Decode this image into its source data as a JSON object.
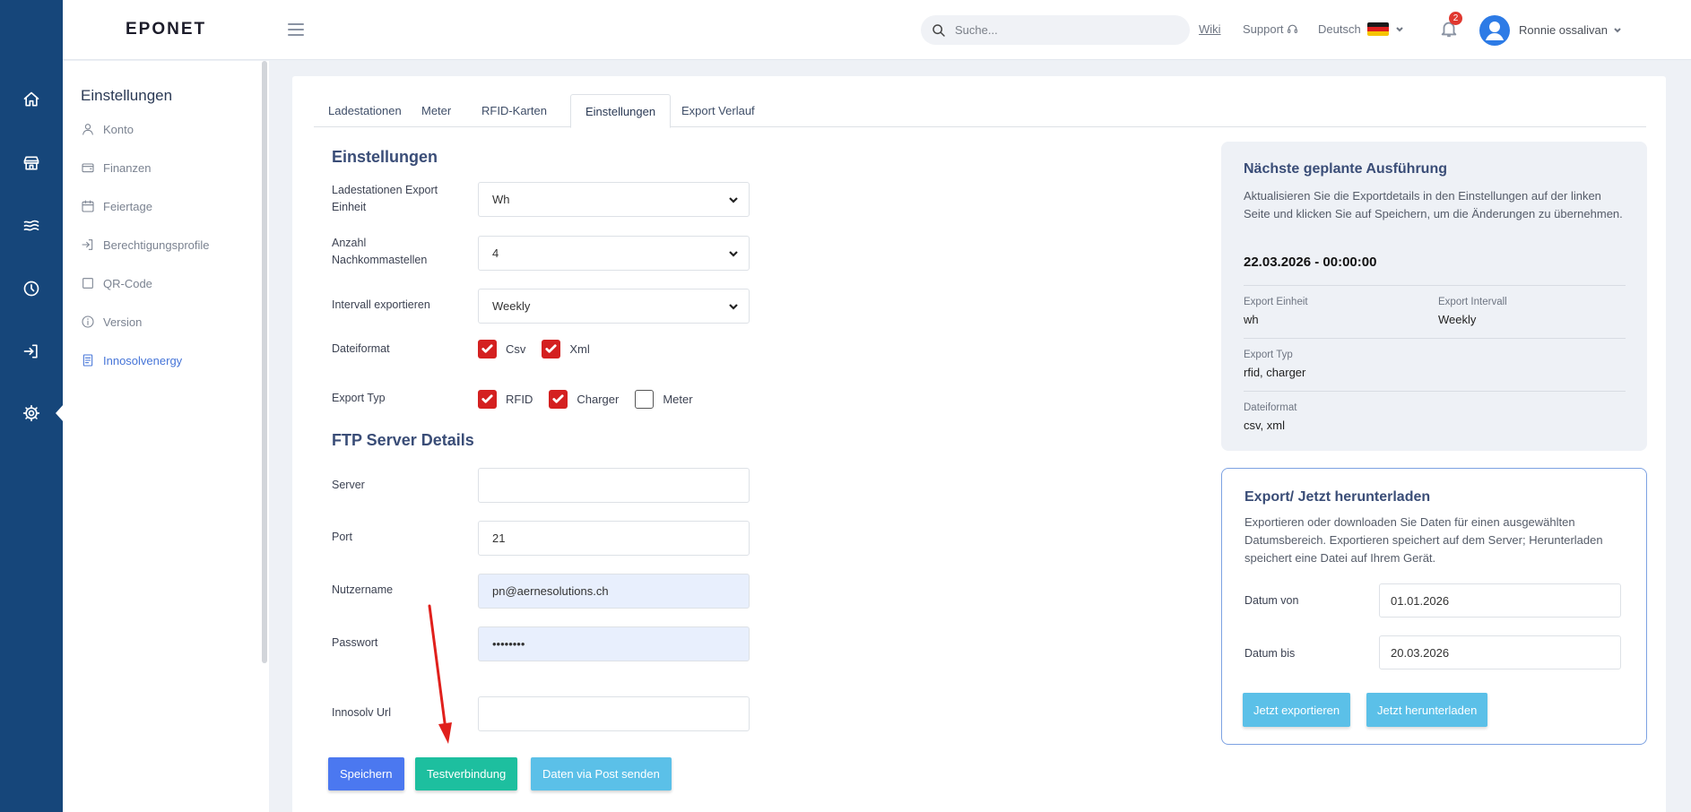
{
  "header": {
    "logo": "EPONET",
    "search_placeholder": "Suche...",
    "wiki": "Wiki",
    "support": "Support",
    "language": "Deutsch",
    "notification_count": "2",
    "username": "Ronnie ossalivan"
  },
  "sidebar": {
    "title": "Einstellungen",
    "items": [
      {
        "label": "Konto",
        "icon": "user-icon"
      },
      {
        "label": "Finanzen",
        "icon": "wallet-icon"
      },
      {
        "label": "Feiertage",
        "icon": "calendar-icon"
      },
      {
        "label": "Berechtigungsprofile",
        "icon": "login-icon"
      },
      {
        "label": "QR-Code",
        "icon": "square-icon"
      },
      {
        "label": "Version",
        "icon": "info-icon"
      },
      {
        "label": "Innosolvenergy",
        "icon": "document-icon",
        "active": true
      }
    ]
  },
  "tabs": [
    "Ladestationen",
    "Meter",
    "RFID-Karten",
    "Einstellungen",
    "Export Verlauf"
  ],
  "active_tab": "Einstellungen",
  "settings": {
    "title": "Einstellungen",
    "export_unit_label_1": "Ladestationen Export",
    "export_unit_label_2": "Einheit",
    "export_unit_value": "Wh",
    "decimals_label_1": "Anzahl",
    "decimals_label_2": "Nachkommastellen",
    "decimals_value": "4",
    "interval_label": "Intervall exportieren",
    "interval_value": "Weekly",
    "format_label": "Dateiformat",
    "format_csv": "Csv",
    "format_xml": "Xml",
    "type_label": "Export Typ",
    "type_rfid": "RFID",
    "type_charger": "Charger",
    "type_meter": "Meter"
  },
  "ftp": {
    "title": "FTP Server Details",
    "server_label": "Server",
    "server_value": "",
    "port_label": "Port",
    "port_value": "21",
    "user_label": "Nutzername",
    "user_value": "pn@aernesolutions.ch",
    "password_label": "Passwort",
    "password_value": "••••••••",
    "url_label": "Innosolv Url",
    "url_value": ""
  },
  "buttons": {
    "save": "Speichern",
    "test": "Testverbindung",
    "post": "Daten via Post senden"
  },
  "next_run": {
    "title": "Nächste geplante Ausführung",
    "desc": "Aktualisieren Sie die Exportdetails in den Einstellungen auf der linken Seite und klicken Sie auf Speichern, um die Änderungen zu übernehmen.",
    "datetime": "22.03.2026 - 00:00:00",
    "unit_label": "Export Einheit",
    "unit_value": "wh",
    "interval_label": "Export Intervall",
    "interval_value": "Weekly",
    "type_label": "Export Typ",
    "type_value": "rfid, charger",
    "format_label": "Dateiformat",
    "format_value": "csv, xml"
  },
  "export_now": {
    "title": "Export/ Jetzt herunterladen",
    "desc": "Exportieren oder downloaden Sie Daten für einen ausgewählten Datumsbereich. Exportieren speichert auf dem Server; Herunterladen speichert eine Datei auf Ihrem Gerät.",
    "from_label": "Datum von",
    "from_value": "01.01.2026",
    "to_label": "Datum bis",
    "to_value": "20.03.2026",
    "export_button": "Jetzt exportieren",
    "download_button": "Jetzt herunterladen"
  },
  "colors": {
    "rail": "#16467a",
    "save": "#4b78f0",
    "test": "#1dbf9f",
    "post": "#5bc0e8",
    "check": "#d42020",
    "annotation_arrow": "#e0201c"
  }
}
